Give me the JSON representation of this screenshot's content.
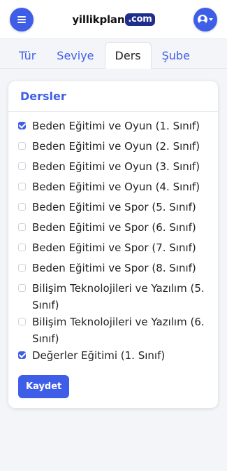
{
  "header": {
    "logo_main": "yillikplan",
    "logo_suffix": ".com",
    "menu_icon": "hamburger-icon",
    "user_icon": "user-circle-icon",
    "accent_color": "#3f5ee8"
  },
  "tabs": [
    {
      "label": "Tür",
      "active": false
    },
    {
      "label": "Seviye",
      "active": false
    },
    {
      "label": "Ders",
      "active": true
    },
    {
      "label": "Şube",
      "active": false
    }
  ],
  "card": {
    "title": "Dersler",
    "items": [
      {
        "label": "Beden Eğitimi ve Oyun (1. Sınıf)",
        "checked": true
      },
      {
        "label": "Beden Eğitimi ve Oyun (2. Sınıf)",
        "checked": false
      },
      {
        "label": "Beden Eğitimi ve Oyun (3. Sınıf)",
        "checked": false
      },
      {
        "label": "Beden Eğitimi ve Oyun (4. Sınıf)",
        "checked": false
      },
      {
        "label": "Beden Eğitimi ve Spor (5. Sınıf)",
        "checked": false
      },
      {
        "label": "Beden Eğitimi ve Spor (6. Sınıf)",
        "checked": false
      },
      {
        "label": "Beden Eğitimi ve Spor (7. Sınıf)",
        "checked": false
      },
      {
        "label": "Beden Eğitimi ve Spor (8. Sınıf)",
        "checked": false
      },
      {
        "label": "Bilişim Teknolojileri ve Yazılım (5. Sınıf)",
        "checked": false
      },
      {
        "label": "Bilişim Teknolojileri ve Yazılım (6. Sınıf)",
        "checked": false
      },
      {
        "label": "Değerler Eğitimi (1. Sınıf)",
        "checked": true
      }
    ],
    "save_label": "Kaydet"
  }
}
